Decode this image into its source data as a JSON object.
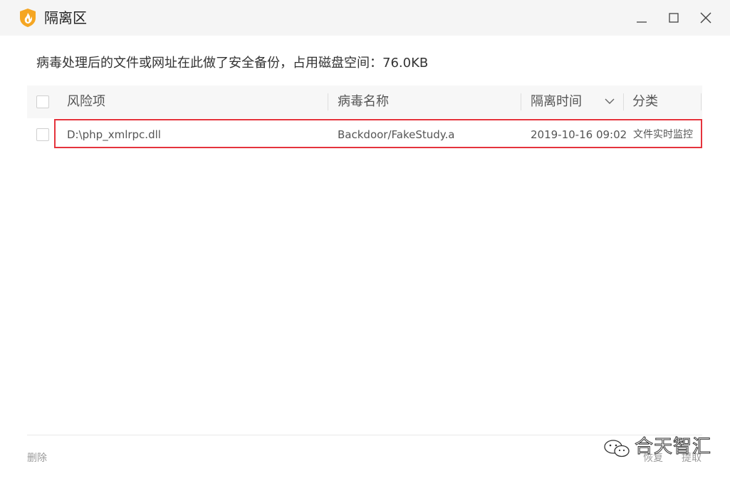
{
  "window": {
    "title": "隔离区",
    "logo_icon": "shield-flame-icon",
    "accent_color": "#f5a623"
  },
  "info": {
    "text": "病毒处理后的文件或网址在此做了安全备份，占用磁盘空间：76.0KB"
  },
  "table": {
    "columns": [
      "风险项",
      "病毒名称",
      "隔离时间",
      "分类"
    ],
    "sort_icon": "chevron-down-icon",
    "rows": [
      {
        "item": "D:\\php_xmlrpc.dll",
        "virus": "Backdoor/FakeStudy.a",
        "time": "2019-10-16 09:02",
        "category": "文件实时监控"
      }
    ],
    "highlight_color": "#e5343d"
  },
  "footer": {
    "delete_label": "删除",
    "restore_label": "恢复",
    "extract_label": "提取"
  },
  "watermark": {
    "text": "合天智汇",
    "icon": "wechat-icon"
  }
}
